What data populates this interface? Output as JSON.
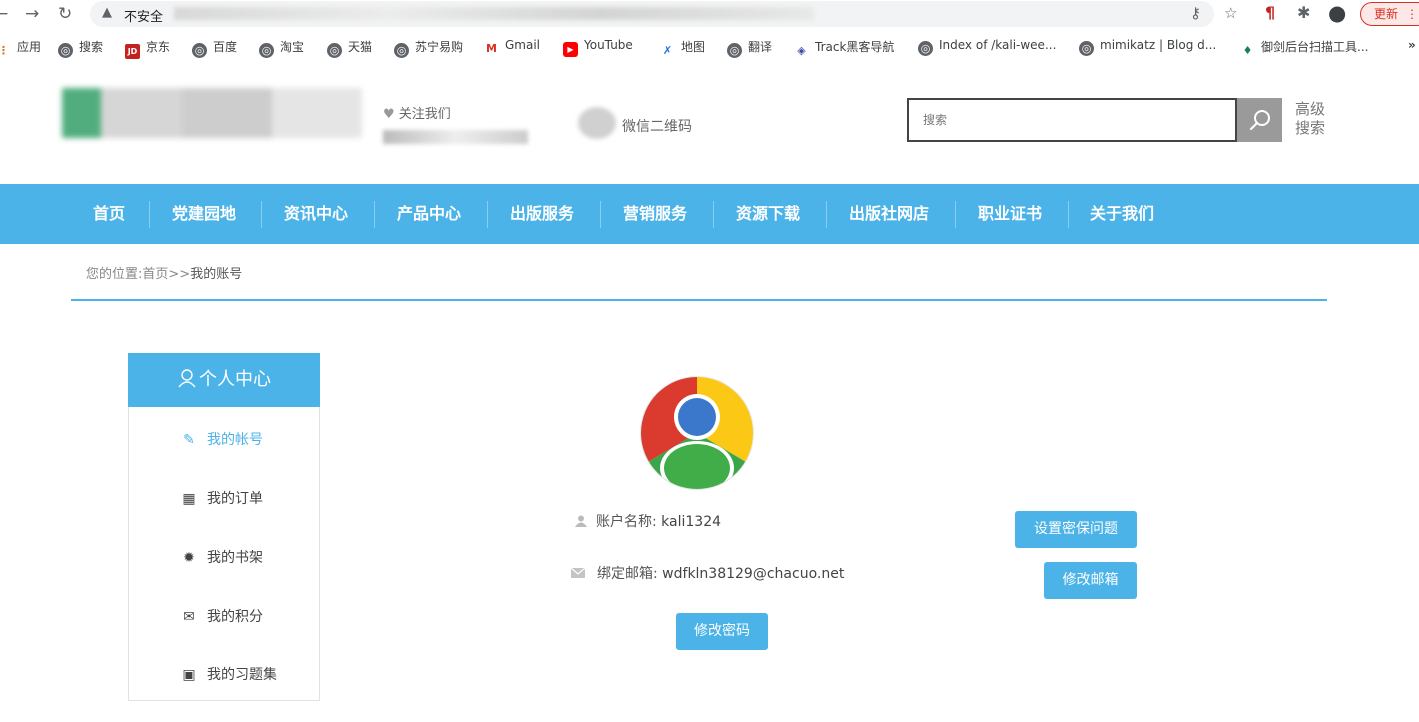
{
  "browser": {
    "omnibox_warning": "不安全",
    "update_label": "更新",
    "more_bookmarks": "»"
  },
  "bookmarks": [
    "应用",
    "搜索",
    "京东",
    "百度",
    "淘宝",
    "天猫",
    "苏宁易购",
    "Gmail",
    "YouTube",
    "地图",
    "翻译",
    "Track黑客导航",
    "Index of /kali-wee...",
    "mimikatz | Blog d...",
    "御剑后台扫描工具..."
  ],
  "header": {
    "follow_us": "关注我们",
    "wechat_qr": "微信二维码",
    "search_placeholder": "搜索",
    "advanced_search_line1": "高级",
    "advanced_search_line2": "搜索"
  },
  "nav": [
    "首页",
    "党建园地",
    "资讯中心",
    "产品中心",
    "出版服务",
    "营销服务",
    "资源下载",
    "出版社网店",
    "职业证书",
    "关于我们"
  ],
  "breadcrumb": {
    "label": "您的位置:",
    "home": "首页",
    "separator": ">>",
    "current": "我的账号"
  },
  "sidebar": {
    "title": "个人中心",
    "items": [
      {
        "label": "我的帐号",
        "icon": "pencil-icon",
        "active": true
      },
      {
        "label": "我的订单",
        "icon": "grid-icon",
        "active": false
      },
      {
        "label": "我的书架",
        "icon": "gear-icon",
        "active": false
      },
      {
        "label": "我的积分",
        "icon": "envelope-icon",
        "active": false
      },
      {
        "label": "我的习题集",
        "icon": "calendar-icon",
        "active": false
      }
    ]
  },
  "profile": {
    "account_label": "账户名称:",
    "account_name": "kali1324",
    "email_label": "绑定邮箱:",
    "email": "wdfkln38129@chacuo.net",
    "security_question_button": "设置密保问题",
    "change_email_button": "修改邮箱",
    "change_password_button": "修改密码"
  },
  "colors": {
    "accent": "#4bb3e8",
    "warning_red": "#d93025"
  }
}
